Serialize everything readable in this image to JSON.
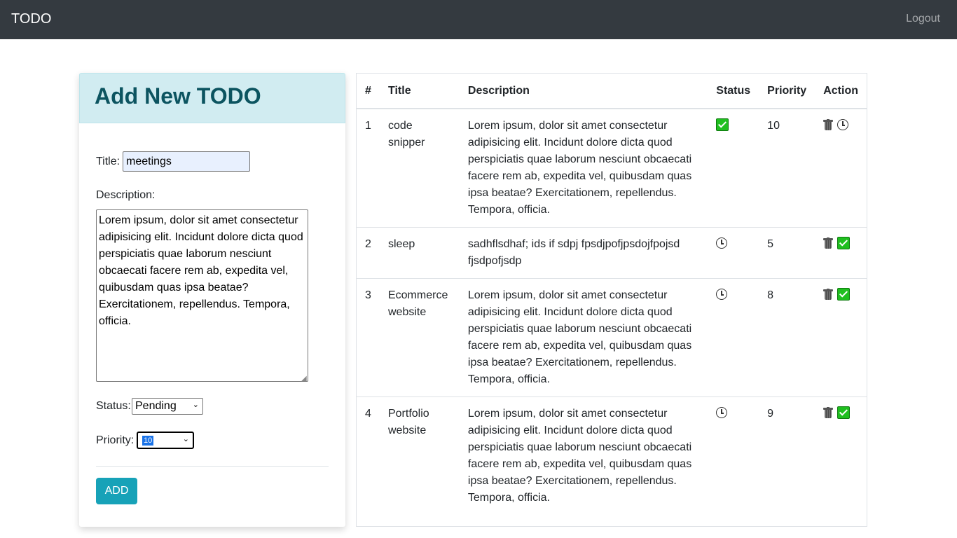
{
  "navbar": {
    "brand": "TODO",
    "logout": "Logout"
  },
  "form": {
    "header": "Add New TODO",
    "title_label": "Title:",
    "title_value": "meetings",
    "description_label": "Description:",
    "description_value": "Lorem ipsum, dolor sit amet consectetur adipisicing elit. Incidunt dolore dicta quod perspiciatis quae laborum nesciunt obcaecati facere rem ab, expedita vel, quibusdam quas ipsa beatae? Exercitationem, repellendus. Tempora, officia.",
    "status_label": "Status:",
    "status_value": "Pending",
    "priority_label": "Priority:",
    "priority_value": "10",
    "add_label": "ADD"
  },
  "table": {
    "headers": [
      "#",
      "Title",
      "Description",
      "Status",
      "Priority",
      "Action"
    ],
    "rows": [
      {
        "num": "1",
        "title": "code snipper",
        "description": "Lorem ipsum, dolor sit amet consectetur adipisicing elit. Incidunt dolore dicta quod perspiciatis quae laborum nesciunt obcaecati facere rem ab, expedita vel, quibusdam quas ipsa beatae? Exercitationem, repellendus. Tempora, officia.",
        "status_icon": "check-icon",
        "priority": "10",
        "action_icon": "clock-icon"
      },
      {
        "num": "2",
        "title": "sleep",
        "description": "sadhflsdhaf; ids if sdpj fpsdjpofjpsdojfpojsd fjsdpofjsdp",
        "status_icon": "clock-icon",
        "priority": "5",
        "action_icon": "check-icon"
      },
      {
        "num": "3",
        "title": "Ecommerce website",
        "description": "Lorem ipsum, dolor sit amet consectetur adipisicing elit. Incidunt dolore dicta quod perspiciatis quae laborum nesciunt obcaecati facere rem ab, expedita vel, quibusdam quas ipsa beatae? Exercitationem, repellendus. Tempora, officia.",
        "status_icon": "clock-icon",
        "priority": "8",
        "action_icon": "check-icon"
      },
      {
        "num": "4",
        "title": "Portfolio website",
        "description": "Lorem ipsum, dolor sit amet consectetur adipisicing elit. Incidunt dolore dicta quod perspiciatis quae laborum nesciunt obcaecati facere rem ab, expedita vel, quibusdam quas ipsa beatae? Exercitationem, repellendus. Tempora, officia.",
        "status_icon": "clock-icon",
        "priority": "9",
        "action_icon": "check-icon"
      }
    ]
  },
  "colors": {
    "navbar_bg": "#343a40",
    "header_bg": "#d1ecf1",
    "header_text": "#0c5460",
    "add_button": "#17a2b8",
    "check_green": "#1fbf1f"
  }
}
